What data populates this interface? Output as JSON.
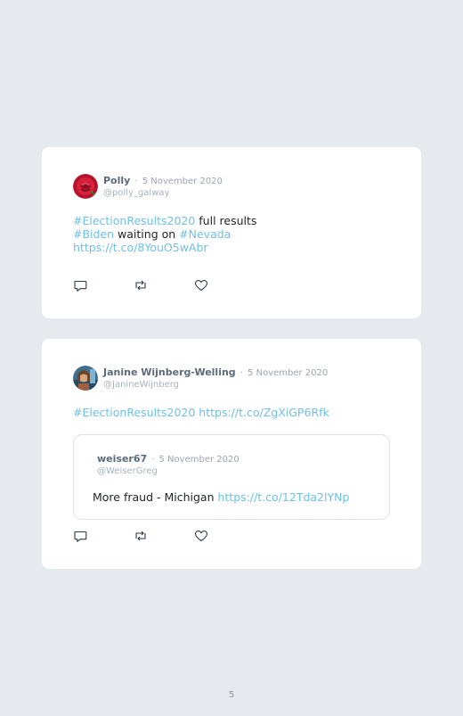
{
  "tweets": [
    {
      "name": "Polly",
      "separator": "·",
      "date": "5 November 2020",
      "handle": "@polly_galway",
      "lines": [
        {
          "hashtag": "#ElectionResults2020",
          "text": " full results"
        },
        {
          "hashtag1": "#Biden",
          "text": " waiting on ",
          "hashtag2": "#Nevada"
        },
        {
          "url": "https://t.co/8YouO5wAbr"
        }
      ],
      "avatar_color": "#c8102e"
    },
    {
      "name": "Janine Wijnberg-Welling",
      "separator": "·",
      "date": "5 November 2020",
      "handle": "@JanineWijnberg",
      "lines": [
        {
          "hashtag": "#ElectionResults2020",
          "space": " ",
          "url": "https://t.co/ZgXiGP6Rfk"
        }
      ],
      "quoted": {
        "name": "weiser67",
        "separator": "·",
        "date": "5 November 2020",
        "handle": "@WeiserGreg",
        "text": "More fraud - Michigan ",
        "url": "https://t.co/12Tda2lYNp"
      }
    }
  ],
  "action_icons": [
    "reply-icon",
    "retweet-icon",
    "like-icon"
  ],
  "page_number": "5",
  "colors": {
    "background": "#e6e9ee",
    "card": "#ffffff",
    "link": "#6fbfe6",
    "name": "#5b6b7c",
    "muted": "#9aa5b1"
  }
}
